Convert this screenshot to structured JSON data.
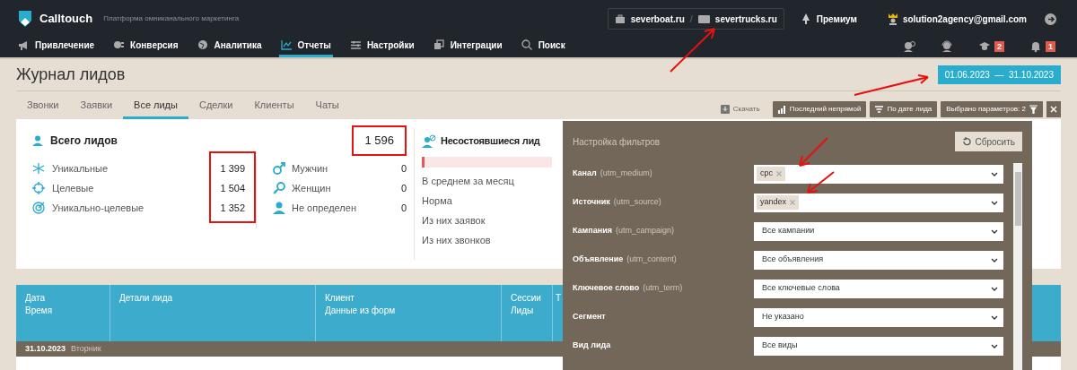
{
  "header": {
    "logo_text": "Calltouch",
    "tagline": "Платформа омниканального маркетинга",
    "sites": [
      {
        "label": "severboat.ru"
      },
      {
        "label": "severtrucks.ru"
      }
    ],
    "site_separator": "/",
    "plan": "Премиум",
    "user": "solution2agency@gmail.com"
  },
  "nav": {
    "items": [
      {
        "label": "Привлечение",
        "selected": false
      },
      {
        "label": "Конверсия",
        "selected": false
      },
      {
        "label": "Аналитика",
        "selected": false
      },
      {
        "label": "Отчеты",
        "selected": true
      },
      {
        "label": "Настройки",
        "selected": false
      },
      {
        "label": "Интеграции",
        "selected": false
      },
      {
        "label": "Поиск",
        "selected": false
      }
    ],
    "tools": [
      {
        "kind": "support"
      },
      {
        "kind": "manager"
      },
      {
        "kind": "learning",
        "badge": "2"
      },
      {
        "kind": "bell",
        "badge": "1"
      }
    ]
  },
  "page": {
    "title": "Журнал лидов",
    "date_range": "01.06.2023  —  31.10.2023"
  },
  "tabs": [
    {
      "label": "Звонки",
      "selected": false
    },
    {
      "label": "Заявки",
      "selected": false
    },
    {
      "label": "Все лиды",
      "selected": true
    },
    {
      "label": "Сделки",
      "selected": false
    },
    {
      "label": "Клиенты",
      "selected": false
    },
    {
      "label": "Чаты",
      "selected": false
    }
  ],
  "toolbar": {
    "download": "Скачать",
    "buttons": [
      {
        "kind": "attribution",
        "label": "Последний непрямой"
      },
      {
        "kind": "sort",
        "label": "По дате лида"
      },
      {
        "kind": "filter",
        "label": "Выбрано параметров: 2"
      }
    ]
  },
  "summary": {
    "total": {
      "label": "Всего лидов",
      "value": "1 596",
      "highlighted": true
    },
    "types_highlighted": true,
    "types": [
      {
        "kind": "unique",
        "label": "Уникальные",
        "value": "1 399"
      },
      {
        "kind": "target",
        "label": "Целевые",
        "value": "1 504"
      },
      {
        "kind": "unique_target",
        "label": "Уникально-целевые",
        "value": "1 352"
      }
    ],
    "genders": [
      {
        "kind": "male",
        "label": "Мужчин",
        "value": "0"
      },
      {
        "kind": "female",
        "label": "Женщин",
        "value": "0"
      },
      {
        "kind": "unknown",
        "label": "Не определен",
        "value": "0"
      }
    ],
    "failed": {
      "title": "Несостоявшиеся лид",
      "bar": {
        "level": 0.02
      },
      "rows": [
        "В среднем за месяц",
        "Норма",
        "Из них заявок",
        "Из них звонков"
      ]
    }
  },
  "table": {
    "columns": [
      {
        "lines": [
          "Дата",
          "Время"
        ]
      },
      {
        "lines": [
          "Детали лида"
        ]
      },
      {
        "lines": [
          "Клиент",
          "Данные из форм"
        ]
      },
      {
        "lines": [
          "Сессии",
          "Лиды"
        ]
      },
      {
        "lines": [
          "Т"
        ]
      }
    ],
    "date_row": {
      "date": "31.10.2023",
      "weekday": "Вторник"
    }
  },
  "filters": {
    "title": "Настройка фильтров",
    "reset": "Сбросить",
    "rows": [
      {
        "label": "Канал",
        "hint": "(utm_medium)",
        "kind": "tags",
        "tags": [
          "cpc"
        ]
      },
      {
        "label": "Источник",
        "hint": "(utm_source)",
        "kind": "tags",
        "tags": [
          "yandex"
        ]
      },
      {
        "label": "Кампания",
        "hint": "(utm_campaign)",
        "kind": "select",
        "value": "Все кампании"
      },
      {
        "label": "Объявление",
        "hint": "(utm_content)",
        "kind": "select",
        "value": "Все объявления"
      },
      {
        "label": "Ключевое слово",
        "hint": "(utm_term)",
        "kind": "select",
        "value": "Все ключевые слова"
      },
      {
        "label": "Сегмент",
        "kind": "select",
        "value": "Не указано"
      },
      {
        "label": "Вид лида",
        "kind": "select",
        "value": "Все виды"
      }
    ]
  }
}
